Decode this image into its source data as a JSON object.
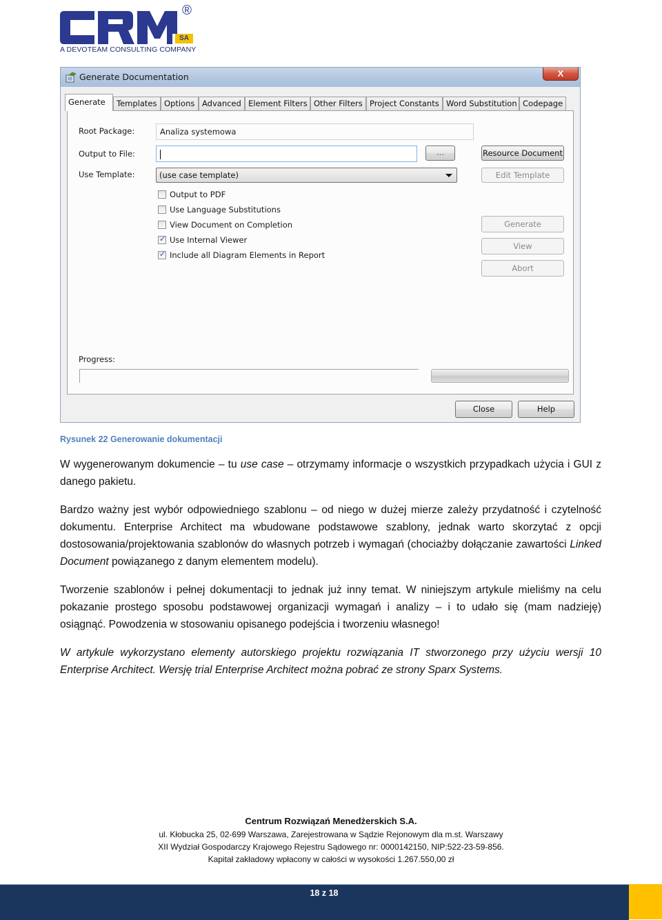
{
  "logo": {
    "wordmark": "CRM",
    "suffix": "SA",
    "registered": "®",
    "tagline": "A DEVOTEAM CONSULTING COMPANY",
    "colors": {
      "primary": "#2b3990",
      "accent": "#f2c200"
    }
  },
  "dialog": {
    "title": "Generate Documentation",
    "close_label": "X",
    "tabs": [
      {
        "label": "Generate",
        "active": true
      },
      {
        "label": "Templates",
        "active": false
      },
      {
        "label": "Options",
        "active": false
      },
      {
        "label": "Advanced",
        "active": false
      },
      {
        "label": "Element Filters",
        "active": false
      },
      {
        "label": "Other Filters",
        "active": false
      },
      {
        "label": "Project Constants",
        "active": false
      },
      {
        "label": "Word Substitution",
        "active": false
      },
      {
        "label": "Codepage",
        "active": false
      }
    ],
    "root_package": {
      "label": "Root Package:",
      "value": "Analiza systemowa"
    },
    "output_file": {
      "label": "Output to File:",
      "value": "",
      "browse_label": "..."
    },
    "use_template": {
      "label": "Use Template:",
      "selected": "(use case template)"
    },
    "checkboxes": [
      {
        "label": "Output to PDF",
        "checked": false
      },
      {
        "label": "Use Language Substitutions",
        "checked": false
      },
      {
        "label": "View Document on Completion",
        "checked": false
      },
      {
        "label": "Use Internal Viewer",
        "checked": true
      },
      {
        "label": "Include all Diagram Elements in Report",
        "checked": true
      }
    ],
    "buttons": {
      "resource_document": "Resource Document",
      "edit_template": "Edit Template",
      "generate": "Generate",
      "view": "View",
      "abort": "Abort",
      "close": "Close",
      "help": "Help"
    },
    "progress": {
      "label": "Progress:",
      "value_percent": 0
    }
  },
  "caption": "Rysunek 22 Generowanie dokumentacji",
  "paragraphs": {
    "p1": {
      "a": "W wygenerowanym dokumencie – tu ",
      "b_italic": "use case",
      "c": " – otrzymamy informacje o wszystkich przypadkach użycia i GUI z danego pakietu."
    },
    "p2": {
      "a": "Bardzo ważny jest wybór odpowiedniego szablonu – od niego w dużej mierze zależy przydatność i czytelność dokumentu. Enterprise Architect ma wbudowane podstawowe szablony, jednak warto skorzytać z opcji dostosowania/projektowania szablonów do własnych potrzeb i wymagań (chociażby dołączanie zawartości ",
      "b_italic": "Linked Document",
      "c": " powiązanego z danym elementem modelu)."
    },
    "p3": "Tworzenie szablonów i pełnej dokumentacji to jednak już inny temat. W niniejszym artykule mieliśmy na celu pokazanie prostego sposobu podstawowej organizacji wymagań i analizy – i to udało się (mam nadzieję) osiągnąć. Powodzenia w stosowaniu opisanego podejścia i tworzeniu własnego!",
    "p4_italic": "W artykule wykorzystano elementy autorskiego projektu rozwiązania IT stworzonego przy użyciu wersji 10 Enterprise Architect. Wersję trial Enterprise Architect można pobrać ze strony Sparx Systems."
  },
  "footer": {
    "company": "Centrum Rozwiązań Menedżerskich S.A.",
    "line1": "ul. Kłobucka 25, 02-699 Warszawa, Zarejestrowana w Sądzie Rejonowym dla m.st. Warszawy",
    "line2": "XII Wydział Gospodarczy Krajowego Rejestru Sądowego nr: 0000142150, NIP:522-23-59-856.",
    "line3": "Kapitał zakładowy wpłacony w całości w wysokości 1.267.550,00 zł",
    "page_number": "18 z 18",
    "colors": {
      "band": "#1b365d",
      "accent": "#ffc000"
    }
  }
}
